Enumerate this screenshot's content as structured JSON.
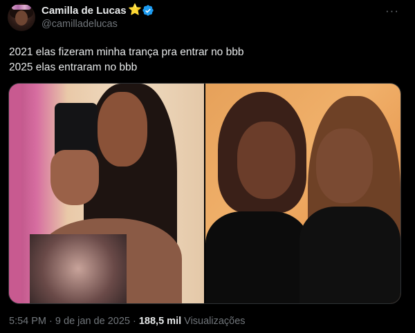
{
  "author": {
    "name": "Camilla de Lucas",
    "handle": "@camilladelucas",
    "badge_icon": "star-emoji",
    "verified_icon": "verified-badge-icon",
    "verified_color": "#1d9bf0"
  },
  "tweet": {
    "line1": "2021 elas fizeram minha trança pra entrar no bbb",
    "line2": "2025 elas entraram no bbb"
  },
  "more_label": "···",
  "meta": {
    "time": "5:54 PM",
    "dot1": "·",
    "date": "9 de jan de 2025",
    "dot2": "·",
    "views": "188,5 mil",
    "views_label": "Visualizações"
  },
  "colors": {
    "background": "#000000",
    "text_primary": "#e7e9ea",
    "text_secondary": "#71767b",
    "border": "#2f3336"
  }
}
